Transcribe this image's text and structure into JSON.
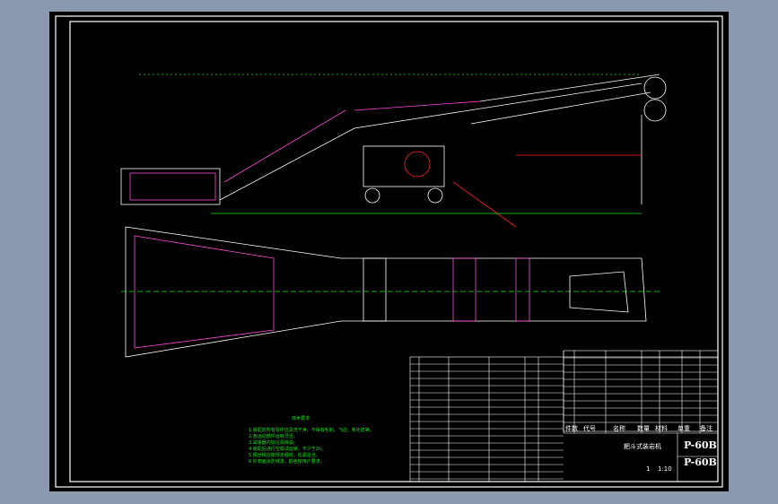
{
  "drawing": {
    "notes_title": "技术要求",
    "notes": [
      "1.装配前所有零件应清洗干净，不得有毛刺、飞边、氧化皮等。",
      "2.各运动部件运转灵活。",
      "3.减速器内加注润滑油。",
      "4.装配后进行空载试运转，不少于2h。",
      "5.钢丝绳应按规定缠绕，松紧适当。",
      "6.外表面涂防锈漆，颜色按用户要求。"
    ],
    "bom_headers": [
      "件数",
      "代号",
      "名称",
      "数量",
      "材料",
      "单重",
      "备注"
    ],
    "title_block": {
      "product_name": "耙斗式装岩机",
      "code": "P-60B",
      "drawing_no": "P-60B",
      "scale": "1:10",
      "sheet": "1"
    }
  },
  "colors": {
    "background": "#8a99ad",
    "paper": "#000000",
    "line": "#ffffff",
    "text_green": "#19e619",
    "accent_magenta": "#ff00ff",
    "accent_red": "#ff2020"
  }
}
